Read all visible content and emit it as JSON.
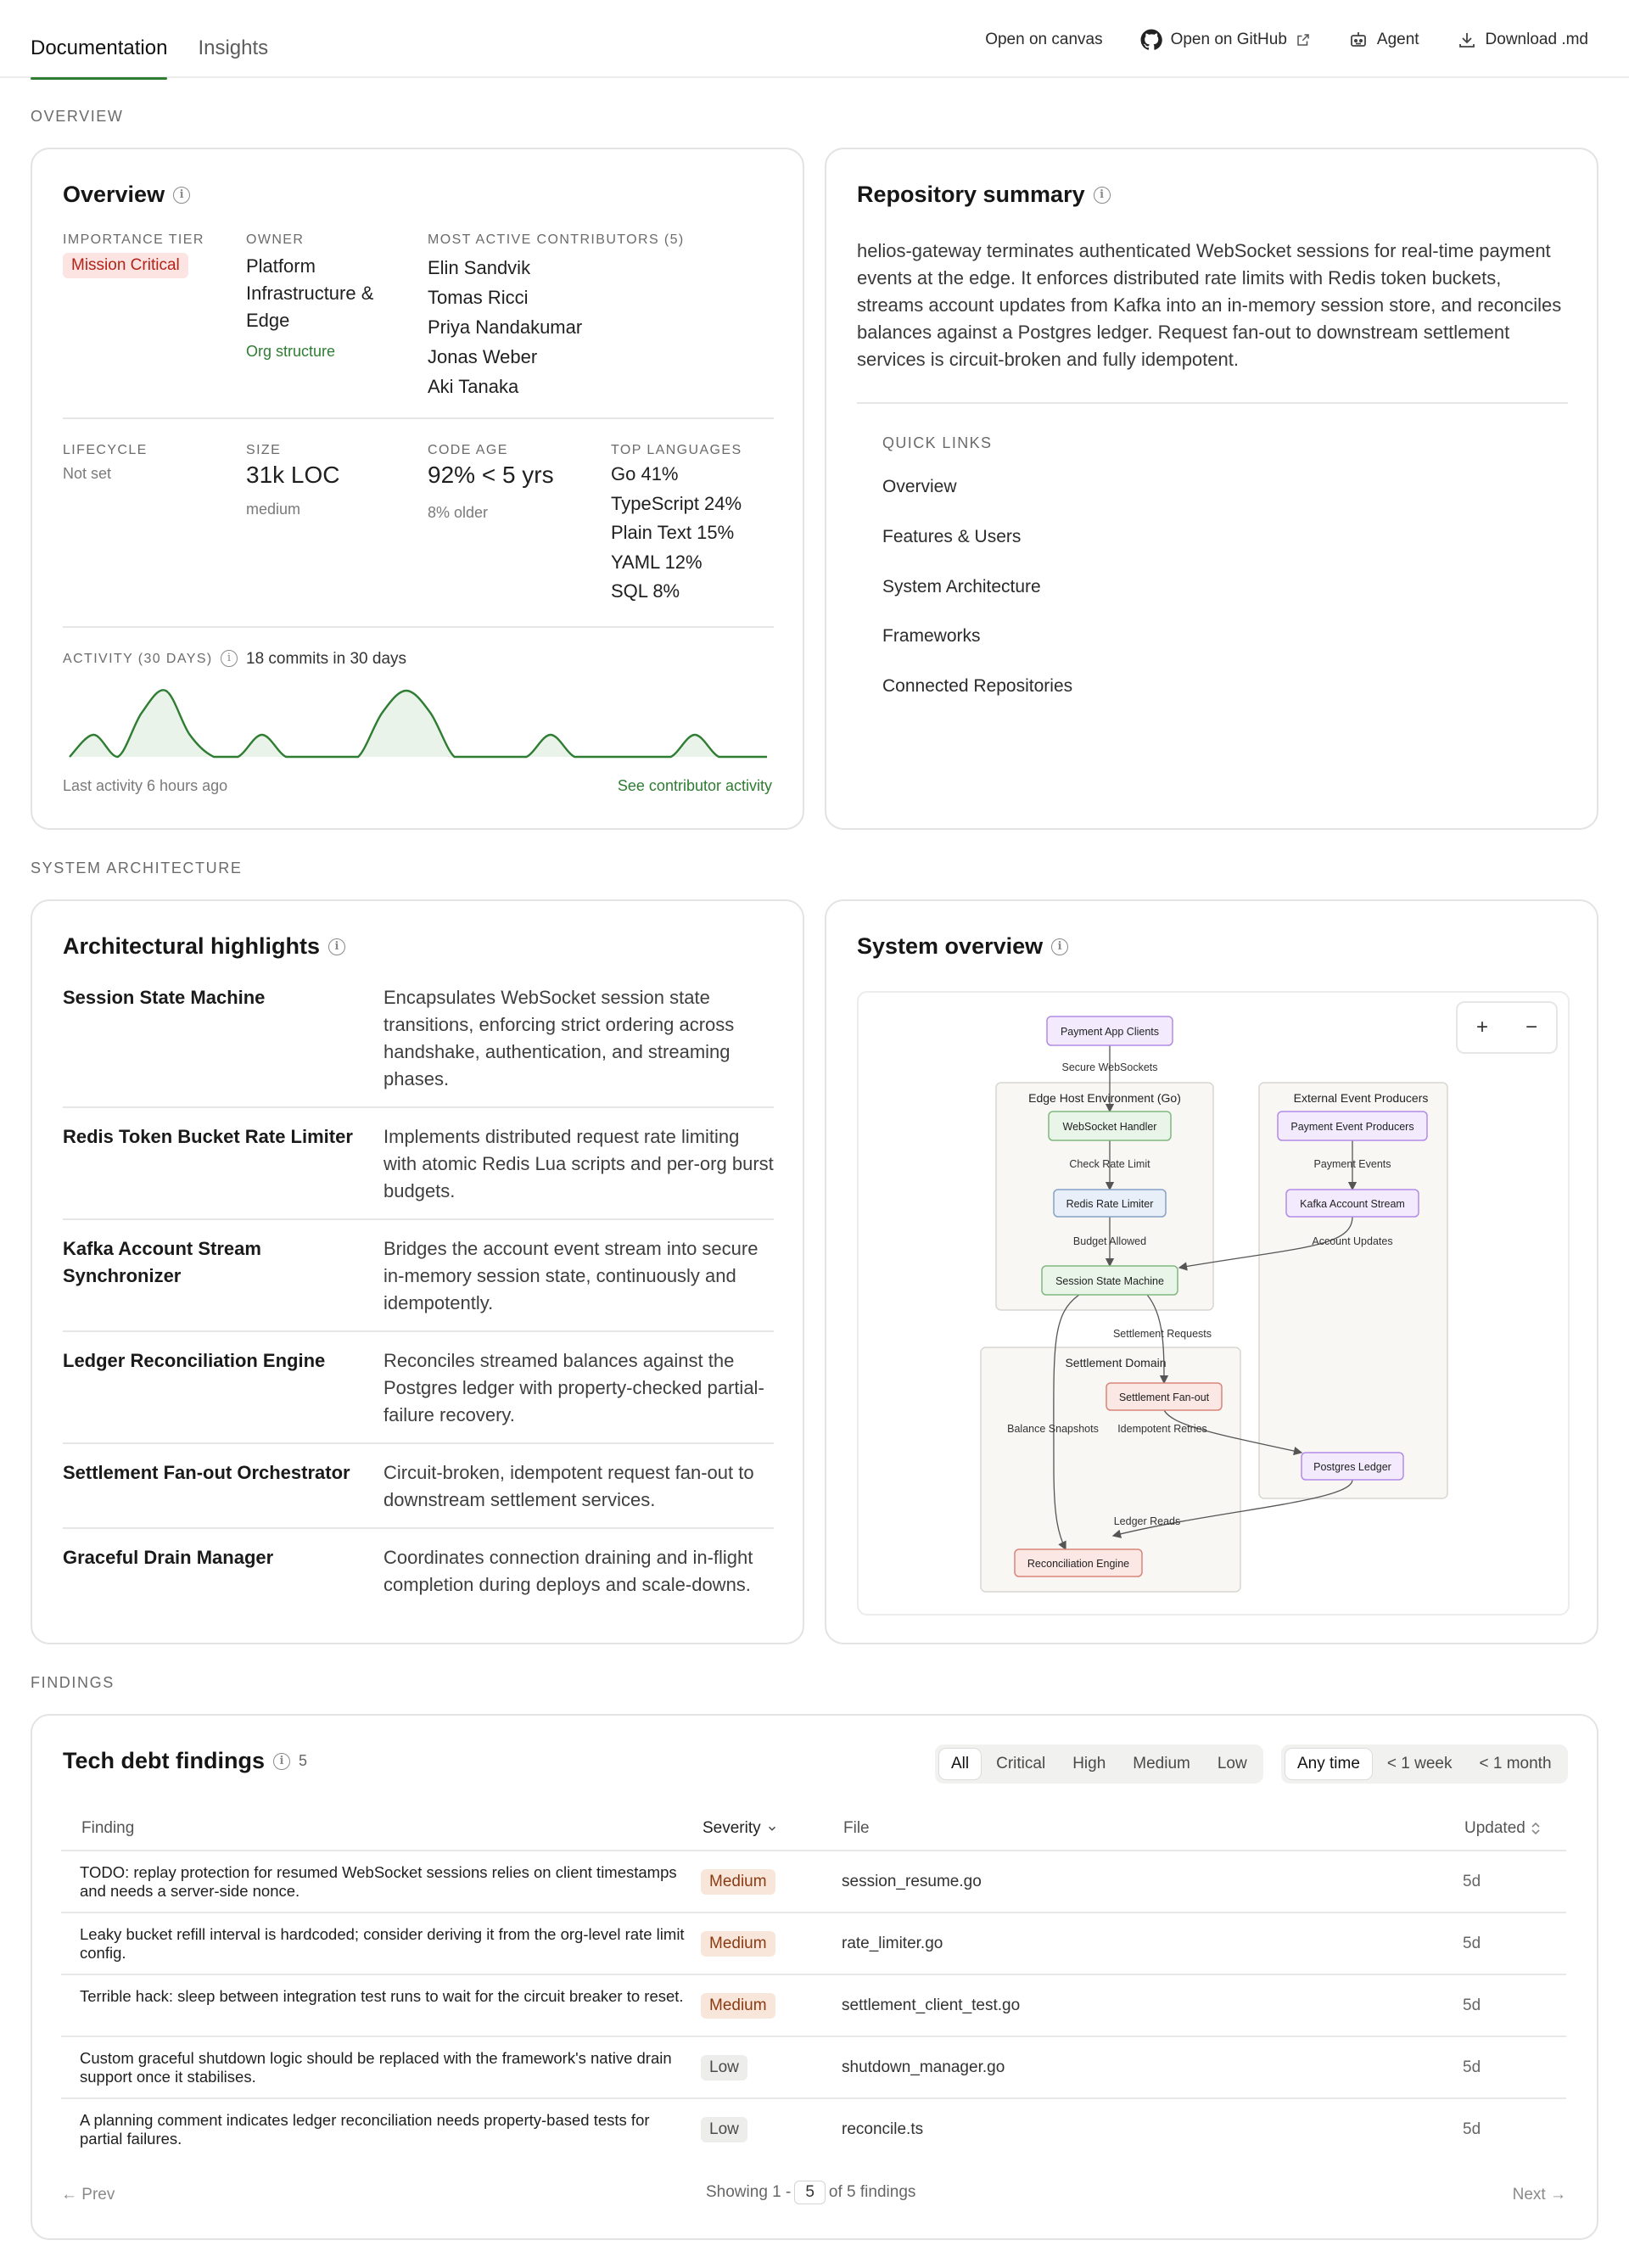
{
  "topbar": {
    "tabs": [
      {
        "label": "Documentation",
        "active": true
      },
      {
        "label": "Insights",
        "active": false
      }
    ],
    "actions": {
      "open_canvas": "Open on canvas",
      "open_github": "Open on GitHub",
      "agent": "Agent",
      "download": "Download .md"
    }
  },
  "sections": {
    "overview": "OVERVIEW",
    "architecture": "SYSTEM ARCHITECTURE",
    "findings": "FINDINGS"
  },
  "overview": {
    "title": "Overview",
    "importance_label": "IMPORTANCE TIER",
    "importance_value": "Mission Critical",
    "owner_label": "OWNER",
    "owner_lines": [
      "Platform",
      "Infrastructure &",
      "Edge"
    ],
    "owner_link": "Org structure",
    "contributors_label": "MOST ACTIVE CONTRIBUTORS (5)",
    "contributors": [
      "Elin Sandvik",
      "Tomas Ricci",
      "Priya Nandakumar",
      "Jonas Weber",
      "Aki Tanaka"
    ],
    "lifecycle_label": "LIFECYCLE",
    "lifecycle_value": "Not set",
    "size_label": "SIZE",
    "size_value": "31k LOC",
    "size_sub": "medium",
    "code_age_label": "CODE AGE",
    "code_age_value": "92% < 5 yrs",
    "code_age_sub": "8% older",
    "languages_label": "TOP LANGUAGES",
    "languages": [
      "Go 41%",
      "TypeScript 24%",
      "Plain Text 15%",
      "YAML 12%",
      "SQL 8%"
    ],
    "activity_label": "ACTIVITY (30 DAYS)",
    "activity_summary": "18 commits in 30 days",
    "activity_series": [
      0,
      1,
      0,
      2,
      3,
      1,
      0,
      0,
      1,
      0,
      0,
      0,
      0,
      2,
      3,
      2,
      0,
      0,
      0,
      0,
      1,
      0,
      0,
      0,
      0,
      0,
      1,
      0,
      0,
      0
    ],
    "last_activity": "Last activity 6 hours ago",
    "contributor_link": "See contributor activity",
    "accent_color": "#2e7d32"
  },
  "repo_summary": {
    "title": "Repository summary",
    "text": "helios-gateway terminates authenticated WebSocket sessions for real-time payment events at the edge. It enforces distributed rate limits with Redis token buckets, streams account updates from Kafka into an in-memory session store, and reconciles balances against a Postgres ledger. Request fan-out to downstream settlement services is circuit-broken and fully idempotent.",
    "quick_links_label": "QUICK LINKS",
    "quick_links": [
      "Overview",
      "Features & Users",
      "System Architecture",
      "Frameworks",
      "Connected Repositories"
    ]
  },
  "highlights": {
    "title": "Architectural highlights",
    "rows": [
      {
        "name": "Session State Machine",
        "desc": "Encapsulates WebSocket session state transitions, enforcing strict ordering across handshake, authentication, and streaming phases."
      },
      {
        "name": "Redis Token Bucket Rate Limiter",
        "desc": "Implements distributed request rate limiting with atomic Redis Lua scripts and per-org burst budgets."
      },
      {
        "name": "Kafka Account Stream Synchronizer",
        "desc": "Bridges the account event stream into secure in-memory session state, continuously and idempotently."
      },
      {
        "name": "Ledger Reconciliation Engine",
        "desc": "Reconciles streamed balances against the Postgres ledger with property-checked partial-failure recovery."
      },
      {
        "name": "Settlement Fan-out Orchestrator",
        "desc": "Circuit-broken, idempotent request fan-out to downstream settlement services."
      },
      {
        "name": "Graceful Drain Manager",
        "desc": "Coordinates connection draining and in-flight completion during deploys and scale-downs."
      }
    ]
  },
  "system_overview": {
    "title": "System overview",
    "zoom_in": "+",
    "zoom_out": "−",
    "groups": {
      "edge": "Edge Host Environment (Go)",
      "external": "External Event Producers",
      "settlement": "Settlement Domain"
    },
    "nodes": {
      "clients": "Payment App Clients",
      "ws_handler": "WebSocket Handler",
      "rate_limiter": "Redis Rate Limiter",
      "session_sm": "Session State Machine",
      "producers": "Payment Event Producers",
      "kafka": "Kafka Account Stream",
      "fanout": "Settlement Fan-out",
      "postgres": "Postgres Ledger",
      "recon": "Reconciliation Engine"
    },
    "edges": {
      "secure_ws": "Secure WebSockets",
      "check_rate": "Check Rate Limit",
      "budget": "Budget Allowed",
      "payment_events": "Payment Events",
      "account_updates": "Account Updates",
      "settlement_requests": "Settlement Requests",
      "balance_snapshots": "Balance Snapshots",
      "idempotent_retries": "Idempotent Retries",
      "ledger_reads": "Ledger Reads"
    },
    "colors": {
      "purple_fill": "#f3ebfd",
      "purple_stroke": "#b38be6",
      "green_fill": "#eaf5ea",
      "green_stroke": "#7fb97f",
      "blue_fill": "#e8eff8",
      "blue_stroke": "#86a2c6",
      "red_fill": "#fbe7e4",
      "red_stroke": "#d8857a",
      "group_fill": "#f8f7f4",
      "group_stroke": "#d8d6d0"
    }
  },
  "findings": {
    "title": "Tech debt findings",
    "count": "5",
    "severity_filters": [
      "All",
      "Critical",
      "High",
      "Medium",
      "Low"
    ],
    "time_filters": [
      "Any time",
      "< 1 week",
      "< 1 month"
    ],
    "columns": {
      "finding": "Finding",
      "severity": "Severity",
      "file": "File",
      "updated": "Updated"
    },
    "rows": [
      {
        "finding": "TODO: replay protection for resumed WebSocket sessions relies on client timestamps and needs a server-side nonce.",
        "severity": "Medium",
        "file": "session_resume.go",
        "updated": "5d"
      },
      {
        "finding": "Leaky bucket refill interval is hardcoded; consider deriving it from the org-level rate limit config.",
        "severity": "Medium",
        "file": "rate_limiter.go",
        "updated": "5d"
      },
      {
        "finding": "Terrible hack: sleep between integration test runs to wait for the circuit breaker to reset.",
        "severity": "Medium",
        "file": "settlement_client_test.go",
        "updated": "5d"
      },
      {
        "finding": "Custom graceful shutdown logic should be replaced with the framework's native drain support once it stabilises.",
        "severity": "Low",
        "file": "shutdown_manager.go",
        "updated": "5d"
      },
      {
        "finding": "A planning comment indicates ledger reconciliation needs property-based tests for partial failures.",
        "severity": "Low",
        "file": "reconcile.ts",
        "updated": "5d"
      }
    ],
    "pager": {
      "prev": "← Prev",
      "showing_prefix": "Showing 1 -",
      "page_size": "5",
      "showing_suffix": "of 5 findings",
      "next": "Next →"
    }
  }
}
